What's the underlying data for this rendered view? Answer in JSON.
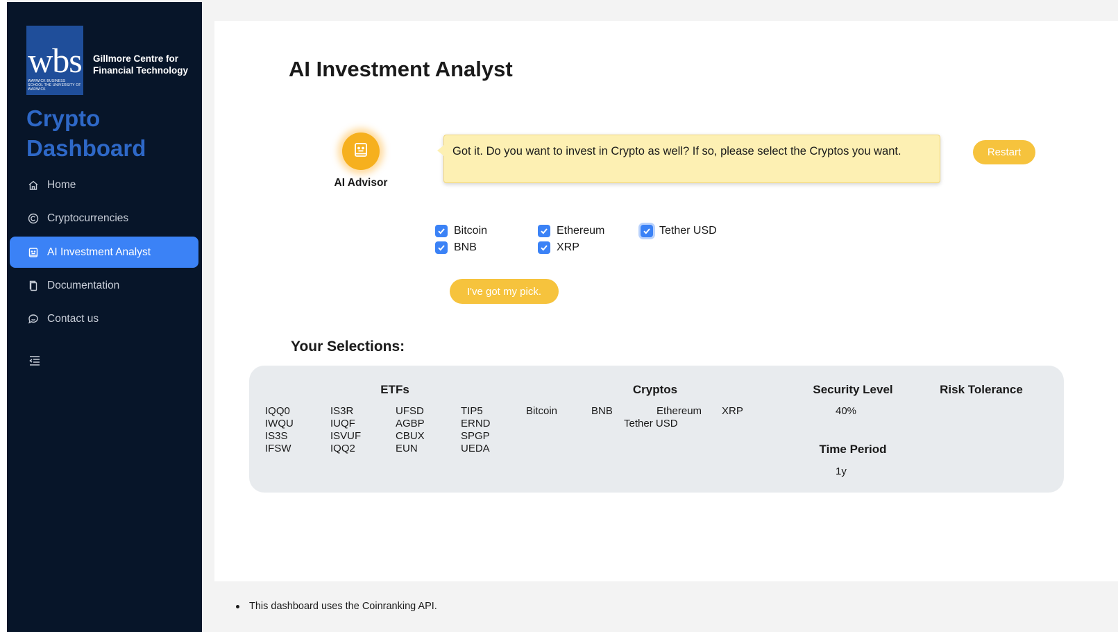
{
  "sidebar": {
    "logo": {
      "letters": "wbs",
      "small_text": "WARWICK BUSINESS SCHOOL THE UNIVERSITY OF WARWICK",
      "org_line1": "Gillmore Centre for",
      "org_line2": "Financial Technology"
    },
    "brand_line1": "Crypto",
    "brand_line2": "Dashboard",
    "items": [
      {
        "label": "Home",
        "icon": "home-icon"
      },
      {
        "label": "Cryptocurrencies",
        "icon": "copyright-icon"
      },
      {
        "label": "AI Investment Analyst",
        "icon": "robot-icon",
        "active": true
      },
      {
        "label": "Documentation",
        "icon": "document-icon"
      },
      {
        "label": "Contact us",
        "icon": "chat-icon"
      }
    ],
    "collapse_icon": "menu-fold-icon"
  },
  "main": {
    "title": "AI Investment Analyst",
    "advisor_label": "AI Advisor",
    "message": "Got it. Do you want to invest in Crypto as well? If so, please select the Cryptos you want.",
    "restart_label": "Restart",
    "pick_label": "I've got my pick.",
    "options": [
      {
        "label": "Bitcoin",
        "checked": true
      },
      {
        "label": "Ethereum",
        "checked": true
      },
      {
        "label": "Tether USD",
        "checked": true
      },
      {
        "label": "BNB",
        "checked": true
      },
      {
        "label": "XRP",
        "checked": true
      }
    ],
    "selections_title": "Your Selections:",
    "selections": {
      "etfs_header": "ETFs",
      "etfs": [
        "IQQ0",
        "IS3R",
        "UFSD",
        "TIP5",
        "IWQU",
        "IUQF",
        "AGBP",
        "ERND",
        "IS3S",
        "ISVUF",
        "CBUX",
        "SPGP",
        "IFSW",
        "IQQ2",
        "EUN",
        "UEDA"
      ],
      "cryptos_header": "Cryptos",
      "cryptos": [
        "Bitcoin",
        "BNB",
        "Ethereum",
        "XRP",
        "Tether USD"
      ],
      "security_header": "Security Level",
      "security_value": "40%",
      "risk_header": "Risk Tolerance",
      "time_header": "Time Period",
      "time_value": "1y"
    }
  },
  "footer": {
    "note": "This dashboard uses the Coinranking API."
  },
  "colors": {
    "sidebar_bg": "#071529",
    "active_bg": "#3b82f6",
    "brand": "#2e68c7",
    "accent_yellow": "#f6c33d",
    "bubble_bg": "#fdf0b3",
    "panel_bg": "#e8ebee"
  }
}
